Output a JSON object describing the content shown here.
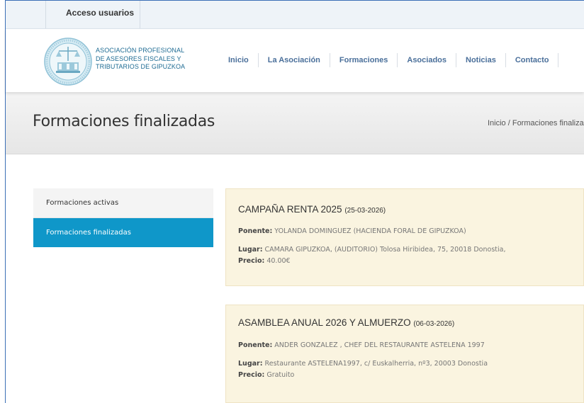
{
  "topbar": {
    "access_label": "Acceso usuarios"
  },
  "logo": {
    "lines": [
      "ASOCIACIÓN PROFESIONAL",
      "DE ASESORES FISCALES Y",
      "TRIBUTARIOS DE GIPUZKOA"
    ]
  },
  "nav": {
    "items": [
      "Inicio",
      "La Asociación",
      "Formaciones",
      "Asociados",
      "Noticias",
      "Contacto"
    ]
  },
  "page": {
    "title": "Formaciones finalizadas",
    "breadcrumb": "Inicio /  Formaciones finaliza"
  },
  "sidebar": {
    "items": [
      {
        "label": "Formaciones activas"
      },
      {
        "label": "Formaciones finalizadas"
      }
    ]
  },
  "colors": {
    "accent": "#0f97c9",
    "card_bg": "#faf4e0",
    "nav_text": "#4a6f9a"
  },
  "cards": [
    {
      "title": "CAMPAÑA RENTA 2025",
      "date": "(25-03-2026)",
      "ponente_label": "Ponente:",
      "ponente": "YOLANDA DOMINGUEZ (HACIENDA FORAL DE GIPUZKOA)",
      "lugar_label": "Lugar:",
      "lugar": "CAMARA GIPUZKOA, (AUDITORIO) Tolosa Hiribidea, 75, 20018 Donostia,",
      "precio_label": "Precio:",
      "precio": "40.00€"
    },
    {
      "title": "ASAMBLEA ANUAL 2026 Y ALMUERZO",
      "date": "(06-03-2026)",
      "ponente_label": "Ponente:",
      "ponente": "ANDER GONZALEZ , CHEF DEL RESTAURANTE ASTELENA 1997",
      "lugar_label": "Lugar:",
      "lugar": "Restaurante ASTELENA1997, c/ Euskalherria, nº3, 20003 Donostia",
      "precio_label": "Precio:",
      "precio": "Gratuito"
    }
  ]
}
